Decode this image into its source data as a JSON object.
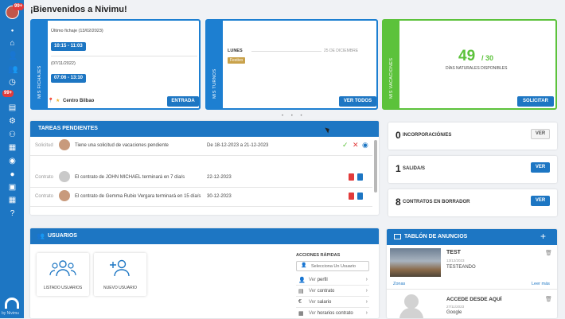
{
  "sidebar": {
    "badge_top": "99+",
    "badge_mid": "99+",
    "brand": "by Nivimu"
  },
  "page": {
    "title": "¡Bienvenidos a Nivimu!"
  },
  "fichajes": {
    "strip": "MIS FICHAJES",
    "last_label": "Último fichaje (13/02/2023)",
    "last_time": "10:15 - 11:03",
    "prev_label": "(07/11/2022)",
    "prev_time": "07:06 - 13:10",
    "location": "Centro Bilbao",
    "button": "ENTRADA"
  },
  "turnos": {
    "strip": "MIS TURNOS",
    "day": "LUNES",
    "date": "25 DE DICIEMBRE",
    "tag": "Festivo",
    "button": "VER TODOS"
  },
  "vacaciones": {
    "strip": "MIS VACACIONES",
    "value": "49",
    "total": "/ 30",
    "label": "DÍAS NATURALES DISPONIBLES",
    "button": "SOLICITAR",
    "color": "#5cc23b"
  },
  "carousel": {
    "dots": "• • •"
  },
  "tareas": {
    "title": "TAREAS PENDIENTES",
    "rows": [
      {
        "type": "Solicitud",
        "text": "Tiene una solicitud de vacaciones pendiente",
        "date": "De 18-12-2023 a 21-12-2023"
      },
      {
        "type": "Contrato",
        "text": "El contrato de JOHN MICHAEL terminará en 7 día/s",
        "date": "22-12-2023"
      },
      {
        "type": "Contrato",
        "text": "El contrato de Gemma Rubio Vergara terminará en 15 día/s",
        "date": "30-12-2023"
      }
    ]
  },
  "kpis": [
    {
      "value": "0",
      "label": "INCORPORACIÓN/ES",
      "button": "VER"
    },
    {
      "value": "1",
      "label": "SALIDA/S",
      "button": "VER"
    },
    {
      "value": "8",
      "label": "CONTRATOS EN BORRADOR",
      "button": "VER"
    }
  ],
  "usuarios": {
    "title": "USUARIOS",
    "tiles": [
      {
        "label": "LISTADO USUARIOS"
      },
      {
        "label": "NUEVO USUARIO"
      }
    ],
    "quick": {
      "title": "ACCIONES RÁPIDAS",
      "select_placeholder": "Selecciona Un Usuario",
      "items": [
        {
          "pre": "Ver",
          "label": "perfil"
        },
        {
          "pre": "Ver",
          "label": "contrato"
        },
        {
          "pre": "Ver",
          "label": "salario"
        },
        {
          "pre": "Ver",
          "label": "horarios contrato"
        }
      ]
    }
  },
  "anuncios": {
    "title": "TABLÓN DE ANUNCIOS",
    "add": "+",
    "items": [
      {
        "title": "TEST",
        "date": "13/12/2023",
        "body": "TESTEANDO",
        "tag": "Zonas",
        "more": "Leer más"
      },
      {
        "title": "ACCEDE DESDE AQUÍ",
        "date": "27/11/2023",
        "body": "Google"
      }
    ]
  }
}
